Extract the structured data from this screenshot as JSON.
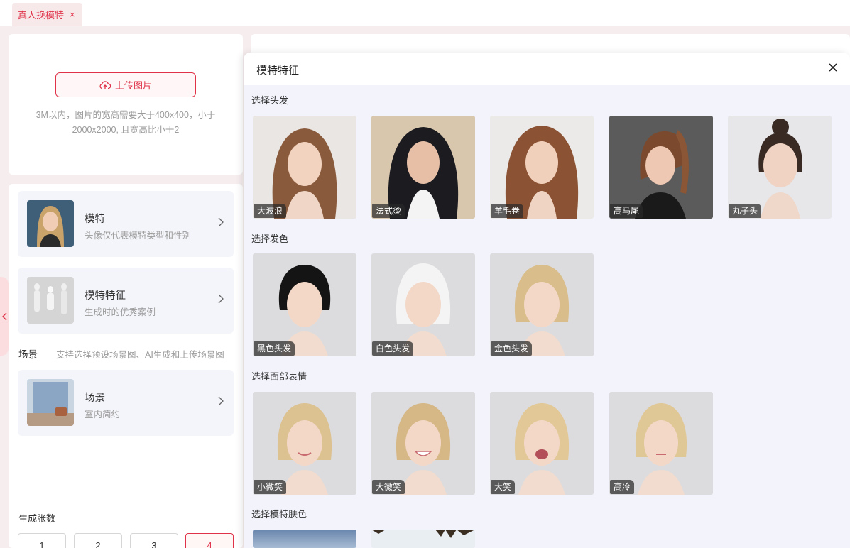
{
  "tabs": [
    {
      "label": "真人换模特",
      "close": "×"
    }
  ],
  "upload": {
    "button_label": "上传图片",
    "hint_line1": "3M以内，图片的宽高需要大于400x400，小于",
    "hint_line2": "2000x2000, 且宽高比小于2"
  },
  "options": [
    {
      "title": "模特",
      "subtitle": "头像仅代表模特类型和性别"
    },
    {
      "title": "模特特征",
      "subtitle": "生成时的优秀案例"
    },
    {
      "title": "场景",
      "subtitle": "室内简约"
    }
  ],
  "scene": {
    "label": "场景",
    "hint": "支持选择预设场景图、AI生成和上传场景图"
  },
  "count": {
    "label": "生成张数",
    "options": [
      "1",
      "2",
      "3",
      "4"
    ],
    "selected": "4"
  },
  "drawer": {
    "title": "模特特征",
    "sections": [
      {
        "label": "选择头发",
        "items": [
          "大波浪",
          "法式烫",
          "羊毛卷",
          "高马尾",
          "丸子头"
        ]
      },
      {
        "label": "选择发色",
        "items": [
          "黑色头发",
          "白色头发",
          "金色头发"
        ]
      },
      {
        "label": "选择面部表情",
        "items": [
          "小微笑",
          "大微笑",
          "大笑",
          "高冷"
        ]
      },
      {
        "label": "选择模特肤色",
        "items": []
      }
    ]
  },
  "colors": {
    "accent": "#e0334a",
    "panel_bg": "#f2f3fb",
    "card_bg": "#f4f5fa"
  }
}
